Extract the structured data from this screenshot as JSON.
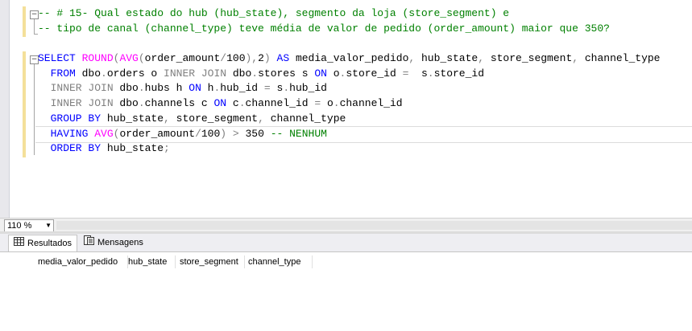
{
  "editor": {
    "lines": [
      [
        {
          "t": "-- # 15- Qual estado do hub (hub_state), segmento da loja (store_segment) e",
          "c": "cm"
        }
      ],
      [
        {
          "t": "-- tipo de canal (channel_type) teve média de valor de pedido (order_amount) maior que 350?",
          "c": "cm"
        }
      ],
      [],
      [
        {
          "t": "SELECT ",
          "c": "kw"
        },
        {
          "t": "ROUND",
          "c": "fn"
        },
        {
          "t": "(",
          "c": "op"
        },
        {
          "t": "AVG",
          "c": "fn"
        },
        {
          "t": "(",
          "c": "op"
        },
        {
          "t": "order_amount",
          "c": ""
        },
        {
          "t": "/",
          "c": "op"
        },
        {
          "t": "100",
          "c": ""
        },
        {
          "t": "),",
          "c": "op"
        },
        {
          "t": "2",
          "c": ""
        },
        {
          "t": ")",
          "c": "op"
        },
        {
          "t": " AS ",
          "c": "kw"
        },
        {
          "t": "media_valor_pedido",
          "c": ""
        },
        {
          "t": ",",
          "c": "op"
        },
        {
          "t": " hub_state",
          "c": ""
        },
        {
          "t": ",",
          "c": "op"
        },
        {
          "t": " store_segment",
          "c": ""
        },
        {
          "t": ",",
          "c": "op"
        },
        {
          "t": " channel_type",
          "c": ""
        }
      ],
      [
        {
          "t": "  FROM ",
          "c": "kw"
        },
        {
          "t": "dbo",
          "c": ""
        },
        {
          "t": ".",
          "c": "op"
        },
        {
          "t": "orders o ",
          "c": ""
        },
        {
          "t": "INNER JOIN",
          "c": "op"
        },
        {
          "t": " dbo",
          "c": ""
        },
        {
          "t": ".",
          "c": "op"
        },
        {
          "t": "stores s ",
          "c": ""
        },
        {
          "t": "ON",
          "c": "kw"
        },
        {
          "t": " o",
          "c": ""
        },
        {
          "t": ".",
          "c": "op"
        },
        {
          "t": "store_id ",
          "c": ""
        },
        {
          "t": "=",
          "c": "op"
        },
        {
          "t": "  s",
          "c": ""
        },
        {
          "t": ".",
          "c": "op"
        },
        {
          "t": "store_id",
          "c": ""
        }
      ],
      [
        {
          "t": "  INNER JOIN",
          "c": "op"
        },
        {
          "t": " dbo",
          "c": ""
        },
        {
          "t": ".",
          "c": "op"
        },
        {
          "t": "hubs h ",
          "c": ""
        },
        {
          "t": "ON",
          "c": "kw"
        },
        {
          "t": " h",
          "c": ""
        },
        {
          "t": ".",
          "c": "op"
        },
        {
          "t": "hub_id ",
          "c": ""
        },
        {
          "t": "=",
          "c": "op"
        },
        {
          "t": " s",
          "c": ""
        },
        {
          "t": ".",
          "c": "op"
        },
        {
          "t": "hub_id",
          "c": ""
        }
      ],
      [
        {
          "t": "  INNER JOIN",
          "c": "op"
        },
        {
          "t": " dbo",
          "c": ""
        },
        {
          "t": ".",
          "c": "op"
        },
        {
          "t": "channels c ",
          "c": ""
        },
        {
          "t": "ON",
          "c": "kw"
        },
        {
          "t": " c",
          "c": ""
        },
        {
          "t": ".",
          "c": "op"
        },
        {
          "t": "channel_id ",
          "c": ""
        },
        {
          "t": "=",
          "c": "op"
        },
        {
          "t": " o",
          "c": ""
        },
        {
          "t": ".",
          "c": "op"
        },
        {
          "t": "channel_id",
          "c": ""
        }
      ],
      [
        {
          "t": "  GROUP BY ",
          "c": "kw"
        },
        {
          "t": "hub_state",
          "c": ""
        },
        {
          "t": ",",
          "c": "op"
        },
        {
          "t": " store_segment",
          "c": ""
        },
        {
          "t": ",",
          "c": "op"
        },
        {
          "t": " channel_type",
          "c": ""
        }
      ],
      [
        {
          "t": "  HAVING ",
          "c": "kw"
        },
        {
          "t": "AVG",
          "c": "fn"
        },
        {
          "t": "(",
          "c": "op"
        },
        {
          "t": "order_amount",
          "c": ""
        },
        {
          "t": "/",
          "c": "op"
        },
        {
          "t": "100",
          "c": ""
        },
        {
          "t": ")",
          "c": "op"
        },
        {
          "t": " > ",
          "c": "op"
        },
        {
          "t": "350 ",
          "c": ""
        },
        {
          "t": "-- NENHUM",
          "c": "cm"
        }
      ],
      [
        {
          "t": "  ORDER BY ",
          "c": "kw"
        },
        {
          "t": "hub_state",
          "c": ""
        },
        {
          "t": ";",
          "c": "op"
        }
      ]
    ]
  },
  "zoom": {
    "value": "110 %"
  },
  "tabs": {
    "results": "Resultados",
    "messages": "Mensagens"
  },
  "grid": {
    "columns": [
      "media_valor_pedido",
      "hub_state",
      "store_segment",
      "channel_type"
    ]
  },
  "colors": {
    "keyword": "#0000ff",
    "function": "#ff00ff",
    "operator": "#808080",
    "comment": "#008000"
  }
}
